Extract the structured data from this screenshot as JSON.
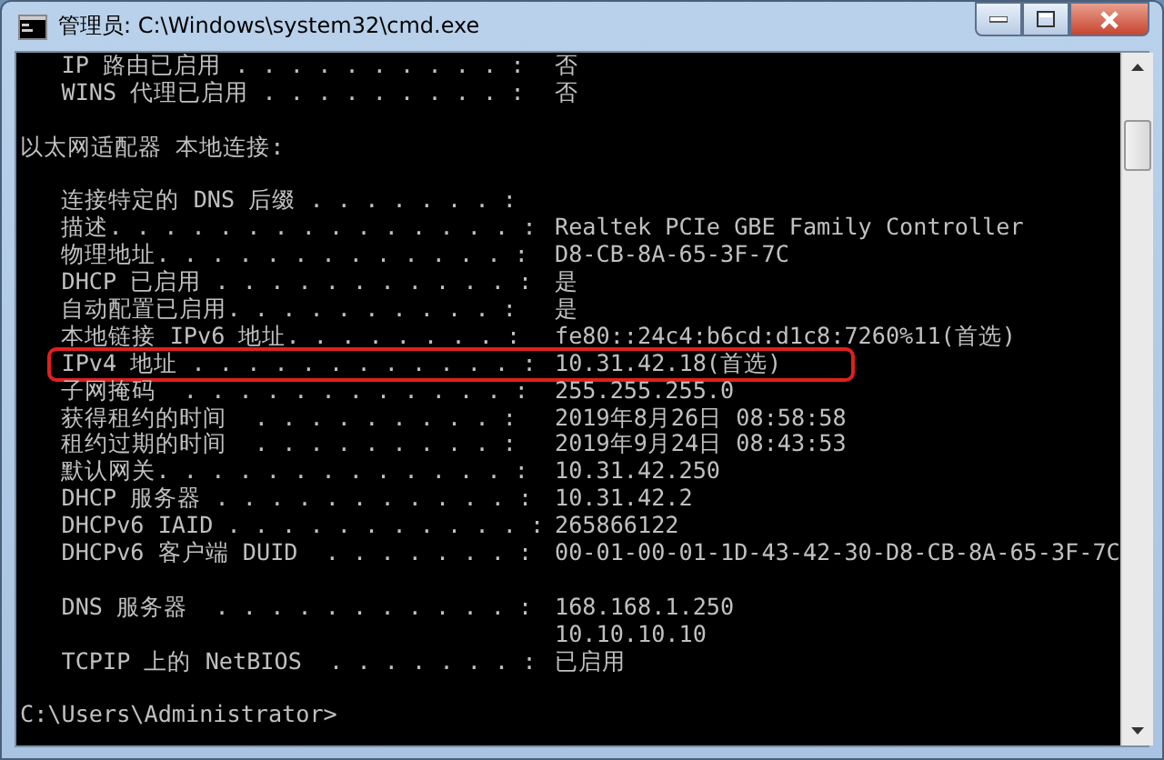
{
  "window": {
    "title": "管理员: C:\\Windows\\system32\\cmd.exe"
  },
  "console": {
    "lines": [
      {
        "kind": "entry",
        "label": "   IP 路由已启用 . . . . . . . . . . :",
        "value": "否",
        "highlighted": false
      },
      {
        "kind": "entry",
        "label": "   WINS 代理已启用 . . . . . . . . . :",
        "value": "否",
        "highlighted": false
      },
      {
        "kind": "blank"
      },
      {
        "kind": "heading",
        "text": "以太网适配器 本地连接:"
      },
      {
        "kind": "blank"
      },
      {
        "kind": "entry",
        "label": "   连接特定的 DNS 后缀 . . . . . . . :",
        "highlighted": false
      },
      {
        "kind": "entry",
        "label": "   描述. . . . . . . . . . . . . . . :",
        "value": "Realtek PCIe GBE Family Controller",
        "highlighted": false
      },
      {
        "kind": "entry",
        "label": "   物理地址. . . . . . . . . . . . . :",
        "value": "D8-CB-8A-65-3F-7C",
        "highlighted": false
      },
      {
        "kind": "entry",
        "label": "   DHCP 已启用 . . . . . . . . . . . :",
        "value": "是",
        "highlighted": false
      },
      {
        "kind": "entry",
        "label": "   自动配置已启用. . . . . . . . . . :",
        "value": "是",
        "highlighted": false
      },
      {
        "kind": "entry",
        "label": "   本地链接 IPv6 地址. . . . . . . . :",
        "value": "fe80::24c4:b6cd:d1c8:7260%11(首选)",
        "highlighted": false
      },
      {
        "kind": "entry",
        "label": "   IPv4 地址 . . . . . . . . . . . . :",
        "value": "10.31.42.18(首选)",
        "highlighted": true
      },
      {
        "kind": "entry",
        "label": "   子网掩码  . . . . . . . . . . . . :",
        "value": "255.255.255.0",
        "highlighted": false
      },
      {
        "kind": "entry",
        "label": "   获得租约的时间  . . . . . . . . . :",
        "value": "2019年8月26日 08:58:58",
        "highlighted": false
      },
      {
        "kind": "entry",
        "label": "   租约过期的时间  . . . . . . . . . :",
        "value": "2019年9月24日 08:43:53",
        "highlighted": false
      },
      {
        "kind": "entry",
        "label": "   默认网关. . . . . . . . . . . . . :",
        "value": "10.31.42.250",
        "highlighted": false
      },
      {
        "kind": "entry",
        "label": "   DHCP 服务器 . . . . . . . . . . . :",
        "value": "10.31.42.2",
        "highlighted": false
      },
      {
        "kind": "entry",
        "label": "   DHCPv6 IAID . . . . . . . . . . . :",
        "value": "265866122",
        "highlighted": false
      },
      {
        "kind": "entry",
        "label": "   DHCPv6 客户端 DUID  . . . . . . . :",
        "value": "00-01-00-01-1D-43-42-30-D8-CB-8A-65-3F-7C",
        "highlighted": false
      },
      {
        "kind": "blank"
      },
      {
        "kind": "entry",
        "label": "   DNS 服务器  . . . . . . . . . . . :",
        "value": "168.168.1.250",
        "highlighted": false
      },
      {
        "kind": "continuation",
        "value": "10.10.10.10"
      },
      {
        "kind": "entry",
        "label": "   TCPIP 上的 NetBIOS  . . . . . . . :",
        "value": "已启用",
        "highlighted": false
      },
      {
        "kind": "blank"
      },
      {
        "kind": "heading",
        "text": "C:\\Users\\Administrator>"
      }
    ]
  }
}
